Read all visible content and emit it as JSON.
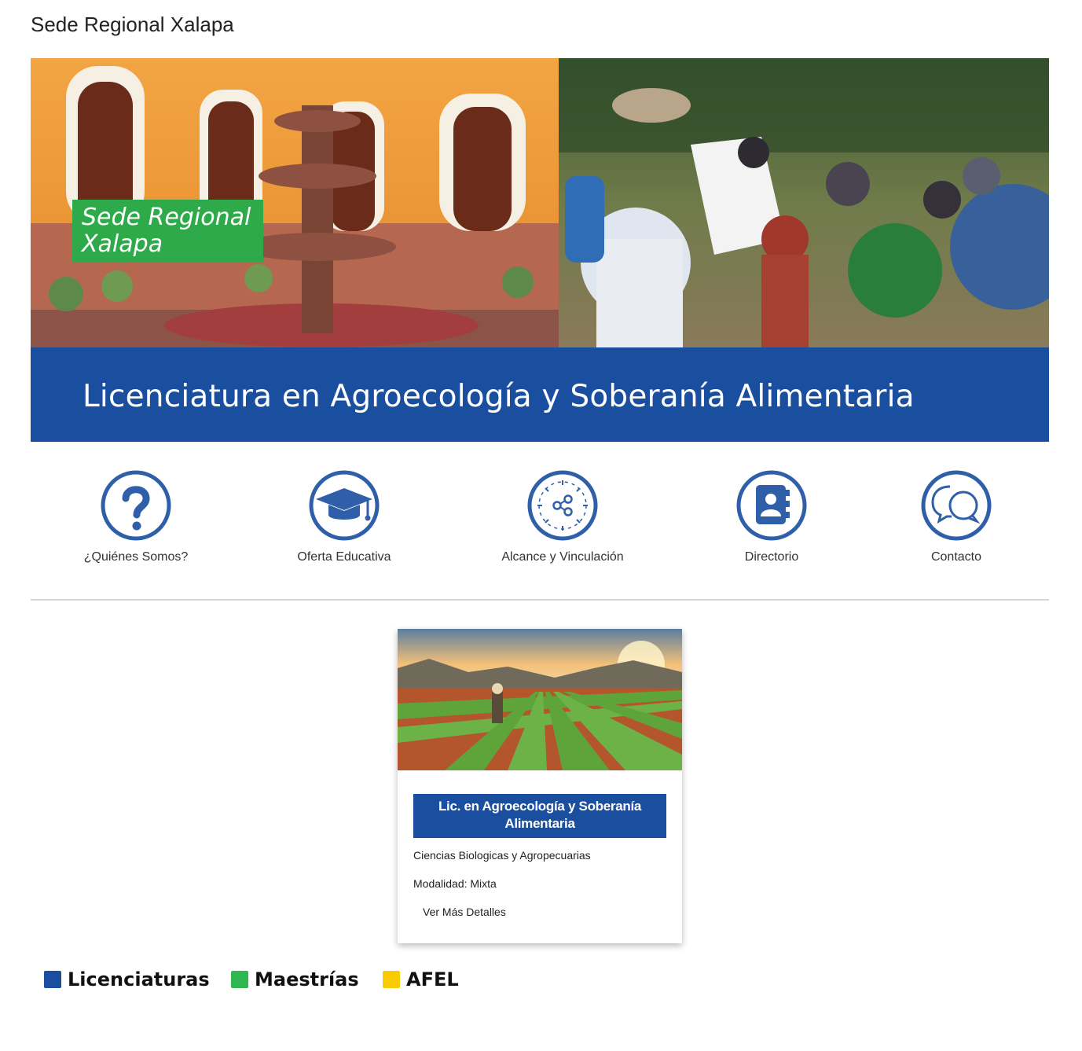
{
  "header": {
    "title": "Sede Regional Xalapa"
  },
  "hero": {
    "badge_line1": "Sede Regional",
    "badge_line2": "Xalapa",
    "band_text": "Licenciatura en Agroecología y Soberanía Alimentaria",
    "colors": {
      "band": "#1a4fa0",
      "badge": "#2eaa4a"
    }
  },
  "nav": {
    "items": [
      {
        "label": "¿Quiénes Somos?",
        "icon": "question-icon"
      },
      {
        "label": "Oferta Educativa",
        "icon": "graduation-cap-icon"
      },
      {
        "label": "Alcance y Vinculación",
        "icon": "network-share-icon"
      },
      {
        "label": "Directorio",
        "icon": "contact-book-icon"
      },
      {
        "label": "Contacto",
        "icon": "chat-bubbles-icon"
      }
    ],
    "icon_color": "#2f5fa8"
  },
  "card": {
    "title": "Lic. en Agroecología y Soberanía Alimentaria",
    "area": "Ciencias Biologicas y Agropecuarias",
    "modality": "Modalidad: Mixta",
    "link": "Ver Más Detalles"
  },
  "legend": {
    "items": [
      {
        "label": "Licenciaturas",
        "color": "#1a4fa0"
      },
      {
        "label": "Maestrías",
        "color": "#2eb84f"
      },
      {
        "label": "AFEL",
        "color": "#f8cc00"
      }
    ]
  }
}
